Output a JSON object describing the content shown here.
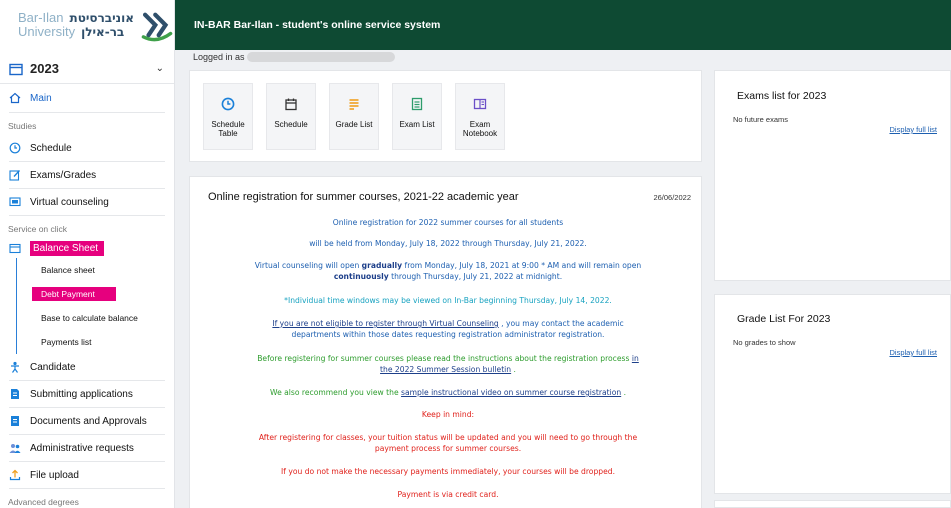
{
  "logo": {
    "en_line1": "Bar-Ilan",
    "en_line2": "University",
    "he_line1": "אוניברסיטת",
    "he_line2": "בר-אילן"
  },
  "header": {
    "title": "IN-BAR Bar-Ilan - student's online service system"
  },
  "session": {
    "logged_in_label": "Logged in as"
  },
  "sidebar": {
    "year": "2023",
    "main": "Main",
    "studies_label": "Studies",
    "studies": [
      "Schedule",
      "Exams/Grades",
      "Virtual counseling"
    ],
    "service_label": "Service on click",
    "balance_sheet": "Balance Sheet",
    "balance_sub": [
      "Balance sheet",
      "Debt Payment",
      "Base to calculate balance",
      "Payments list"
    ],
    "other": [
      "Candidate",
      "Submitting applications",
      "Documents and Approvals",
      "Administrative requests",
      "File upload"
    ],
    "advanced_label": "Advanced degrees"
  },
  "quick_links": [
    {
      "label": "Schedule\nTable",
      "icon": "clock-icon",
      "color": "#1a80d9"
    },
    {
      "label": "Schedule",
      "icon": "calendar-icon",
      "color": "#333333"
    },
    {
      "label": "Grade List",
      "icon": "list-icon",
      "color": "#f0a020"
    },
    {
      "label": "Exam List",
      "icon": "exam-list-icon",
      "color": "#2d9c6b"
    },
    {
      "label": "Exam\nNotebook",
      "icon": "notebook-icon",
      "color": "#6b4fc8"
    }
  ],
  "announcement": {
    "title": "Online registration for summer courses, 2021-22 academic year",
    "date": "26/06/2022",
    "l1": "Online registration for 2022 summer courses for all students",
    "l2": "will be held from Monday, July 18, 2022 through Thursday, July 21, 2022.",
    "l3a": "Virtual counseling will open ",
    "l3b": "gradually",
    "l3c": " from Monday, July 18, 2021 at 9:00  *  AM and will remain open",
    "l4a": "continuously",
    "l4b": " through Thursday, July 21, 2022 at midnight.",
    "l5": "*Individual time windows may be viewed on In-Bar beginning Thursday, July 14, 2022.",
    "l6a": "If you are not eligible to register through Virtual Counseling",
    "l6b": "  , you may contact the academic",
    "l7": "departments within those dates requesting registration administrator registration.",
    "l8a": "Before registering for summer courses please read the instructions about the registration process  ",
    "l8b": "in",
    "l9a": "the 2022 Summer Session bulletin",
    "l9b": " .",
    "l10a": "We also recommend you view the   ",
    "l10b": "sample instructional video on summer course registration",
    "l10c": " .",
    "l11": "Keep in mind:",
    "l12": "After registering for classes, your tuition status will be updated and you will need to go through the",
    "l13": "payment process for summer courses.",
    "l14": "If you do not make the necessary payments immediately, your courses will be dropped.",
    "l15": "Payment is via credit card."
  },
  "exams": {
    "title": "Exams list for 2023",
    "empty": "No future exams",
    "link": "Display full list"
  },
  "grades": {
    "title": "Grade List For 2023",
    "empty": "No grades to show",
    "link": "Display full list"
  }
}
